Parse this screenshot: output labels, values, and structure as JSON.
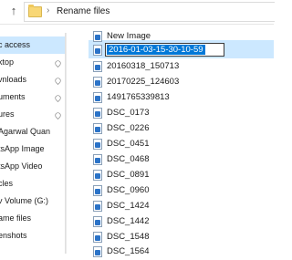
{
  "address_bar": {
    "up_arrow": "↑",
    "separator": "›",
    "path": "Rename files"
  },
  "nav": {
    "items": [
      {
        "label": "c access",
        "pinned": false,
        "selected": true
      },
      {
        "label": "ktop",
        "pinned": true
      },
      {
        "label": "vnloads",
        "pinned": true
      },
      {
        "label": "uments",
        "pinned": true
      },
      {
        "label": "ures",
        "pinned": true
      },
      {
        "label": "Agarwal Quan",
        "pinned": false
      },
      {
        "label": "tsApp Image",
        "pinned": false
      },
      {
        "label": "tsApp Video",
        "pinned": false
      },
      {
        "label": "cles",
        "pinned": false
      },
      {
        "label": "v Volume (G:)",
        "pinned": false
      },
      {
        "label": "ame files",
        "pinned": false
      },
      {
        "label": "enshots",
        "pinned": false
      }
    ]
  },
  "files": {
    "items": [
      {
        "name": "New Image",
        "editing": false
      },
      {
        "name": "2016-01-03-15-30-10-59",
        "editing": true
      },
      {
        "name": "20160318_150713",
        "editing": false
      },
      {
        "name": "20170225_124603",
        "editing": false
      },
      {
        "name": "1491765339813",
        "editing": false
      },
      {
        "name": "DSC_0173",
        "editing": false
      },
      {
        "name": "DSC_0226",
        "editing": false
      },
      {
        "name": "DSC_0451",
        "editing": false
      },
      {
        "name": "DSC_0468",
        "editing": false
      },
      {
        "name": "DSC_0891",
        "editing": false
      },
      {
        "name": "DSC_0960",
        "editing": false
      },
      {
        "name": "DSC_1424",
        "editing": false
      },
      {
        "name": "DSC_1442",
        "editing": false
      },
      {
        "name": "DSC_1548",
        "editing": false
      },
      {
        "name": "DSC_1564",
        "editing": false
      }
    ]
  },
  "colors": {
    "selection": "#cce8ff",
    "text_selection": "#0078d7",
    "folder": "#f8d775",
    "image_icon": "#2b73c8"
  }
}
